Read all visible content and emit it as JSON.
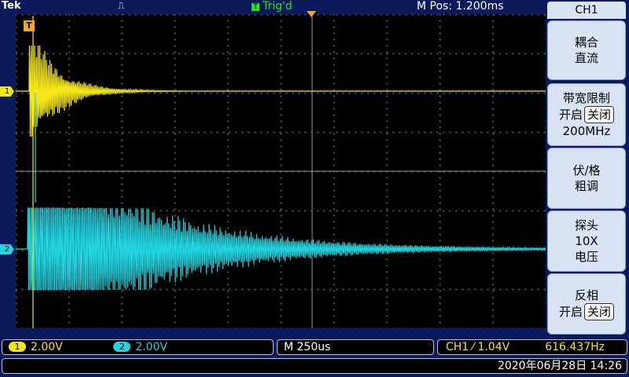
{
  "top": {
    "brand": "Tek",
    "acq_icon": "⎍",
    "trig_status": "Trig'd",
    "trig_icon": "T",
    "mpos": "M Pos: 1.200ms"
  },
  "markers": {
    "trigger_pos": "T",
    "ch1": "1",
    "ch2": "2"
  },
  "menu": {
    "title": "CH1",
    "coupling": {
      "line1": "耦合",
      "line2": "直流"
    },
    "bwlimit": {
      "line1": "带宽限制",
      "on": "开启",
      "off": "关闭",
      "line3": "200MHz"
    },
    "voltsdiv": {
      "line1": "伏/格",
      "line2": "粗调"
    },
    "probe": {
      "line1": "探头",
      "line2": "10X",
      "line3": "电压"
    },
    "invert": {
      "line1": "反相",
      "on": "开启",
      "off": "关闭"
    }
  },
  "status": {
    "ch1_tag": "1",
    "ch1_scale": "2.00V",
    "ch2_tag": "2",
    "ch2_scale": "2.00V",
    "timebase": "M 250us",
    "trigger": "CH1 ⁄ 1.04V",
    "freq": "616.437Hz",
    "datetime": "2020年06月28日 14:26"
  },
  "colors": {
    "ch1": "#f5e61a",
    "ch2": "#21d4e0",
    "background": "#0b1a5c",
    "trig_status": "#1ee31e",
    "menu_button": "#d8e4f3"
  }
}
